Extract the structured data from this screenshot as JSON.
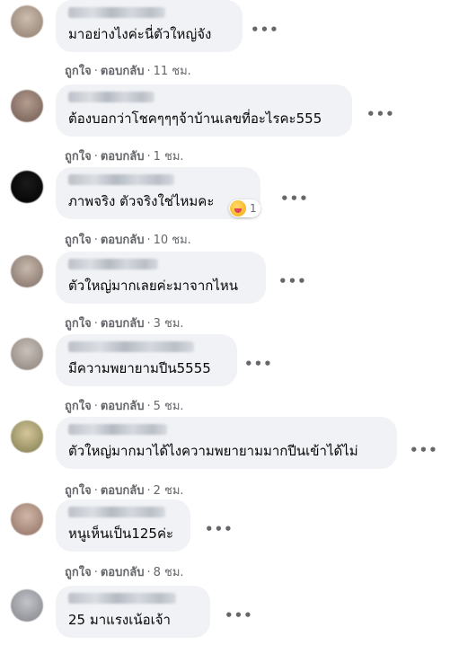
{
  "comments": [
    {
      "text": "มาอย่างไงค่ะนี่ตัวใหญ่จัง",
      "like": "ถูกใจ",
      "reply": "ตอบกลับ",
      "time": "11 ชม.",
      "avatar_colors": [
        "#cbbdb0",
        "#8f7c6b"
      ]
    },
    {
      "text": "ต้องบอกว่าโชคๆๆๆจ้าบ้านเลขที่อะไรคะ555",
      "like": "ถูกใจ",
      "reply": "ตอบกลับ",
      "time": "1 ชม.",
      "avatar_colors": [
        "#b49c8e",
        "#6f5a52"
      ]
    },
    {
      "text": "ภาพจริง ตัวจริงใช่ไหมคะ",
      "like": "ถูกใจ",
      "reply": "ตอบกลับ",
      "time": "10 ชม.",
      "reaction_count": "1",
      "reaction_icon": "wow-emoji-icon",
      "avatar_colors": [
        "#1a1a1a",
        "#000000"
      ]
    },
    {
      "text": "ตัวใหญ่มากเลยค่ะมาจากไหน",
      "like": "ถูกใจ",
      "reply": "ตอบกลับ",
      "time": "3 ชม.",
      "avatar_colors": [
        "#c8b9ad",
        "#7d6c63"
      ]
    },
    {
      "text": "มีความพยายามปีน5555",
      "like": "ถูกใจ",
      "reply": "ตอบกลับ",
      "time": "5 ชม.",
      "avatar_colors": [
        "#c9c1bb",
        "#8a8079"
      ]
    },
    {
      "text": "ตัวใหญ่มากมาได้ไงความพยายามมากปีนเข้าได้ไม่",
      "like": "ถูกใจ",
      "reply": "ตอบกลับ",
      "time": "2 ชม.",
      "avatar_colors": [
        "#d4c79a",
        "#7f7a4e"
      ]
    },
    {
      "text": "หนูเห็นเป็น125ค่ะ",
      "like": "ถูกใจ",
      "reply": "ตอบกลับ",
      "time": "8 ชม.",
      "avatar_colors": [
        "#d1b7a8",
        "#8e6f62"
      ]
    },
    {
      "text": "25 มาแรงเน้อเจ้า",
      "avatar_colors": [
        "#c2c4c9",
        "#808388"
      ]
    }
  ],
  "colors": {
    "bubble": "#f0f2f5",
    "text": "#050505",
    "meta": "#65676b"
  }
}
